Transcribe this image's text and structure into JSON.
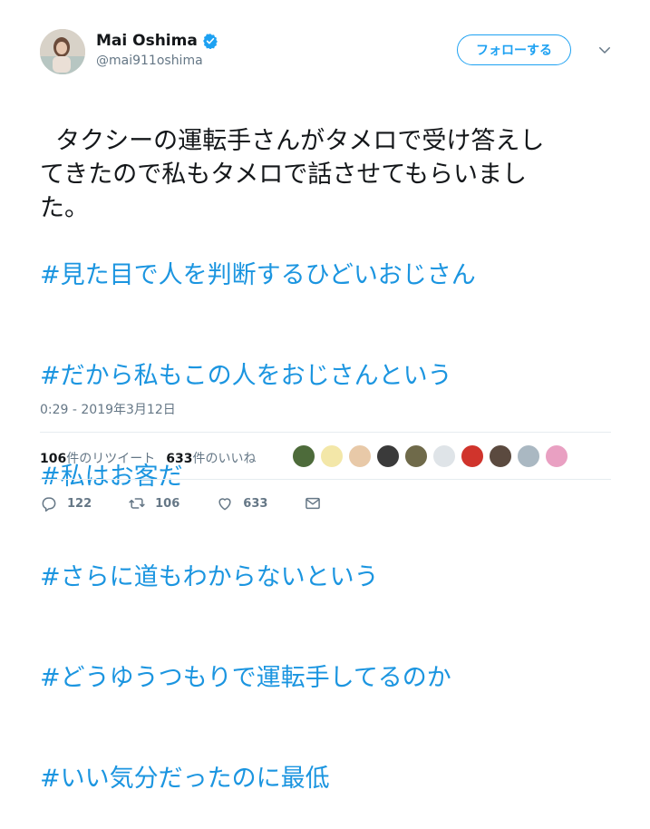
{
  "user": {
    "display_name": "Mai Oshima",
    "handle": "@mai911oshima",
    "verified_icon": "verified-badge-icon"
  },
  "header": {
    "follow_label": "フォローする"
  },
  "tweet": {
    "body": "タクシーの運転手さんがタメロで受け答えし\nてきたので私もタメロで話させてもらいまし\nた。",
    "hashtags": [
      "#見た目で人を判断するひどいおじさん",
      "#だから私もこの人をおじさんという",
      "#私はお客だ",
      "#さらに道もわからないという",
      "#どうゆうつもりで運転手してるのか",
      "#いい気分だったのに最低"
    ],
    "timestamp": "0:29 - 2019年3月12日"
  },
  "stats": {
    "retweets_num": "106",
    "retweets_label": "件のリツイート",
    "likes_num": "633",
    "likes_label": "件のいいね"
  },
  "actions": {
    "reply_count": "122",
    "retweet_count": "106",
    "like_count": "633"
  },
  "colors": {
    "accent": "#1da1f2",
    "hashtag": "#1b95e0",
    "muted": "#657786"
  }
}
